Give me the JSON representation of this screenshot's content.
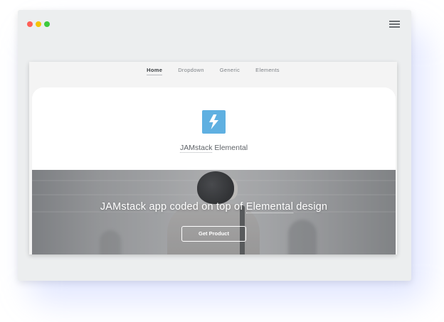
{
  "window": {
    "traffic_lights": [
      "#ff5f57",
      "#f5c400",
      "#3dca3d"
    ],
    "menu_icon": "hamburger-icon"
  },
  "nav": {
    "items": [
      {
        "label": "Home",
        "active": true
      },
      {
        "label": "Dropdown",
        "active": false
      },
      {
        "label": "Generic",
        "active": false
      },
      {
        "label": "Elements",
        "active": false
      }
    ]
  },
  "header": {
    "logo_icon": "lightning-bolt-icon",
    "logo_color": "#5fb0e1",
    "title_underlined": "JAMstack",
    "title_rest": " Elemental"
  },
  "banner": {
    "tagline_before": "JAMstack app coded on top of ",
    "tagline_underlined": "Elemental",
    "tagline_after": " design",
    "cta_label": "Get Product"
  }
}
